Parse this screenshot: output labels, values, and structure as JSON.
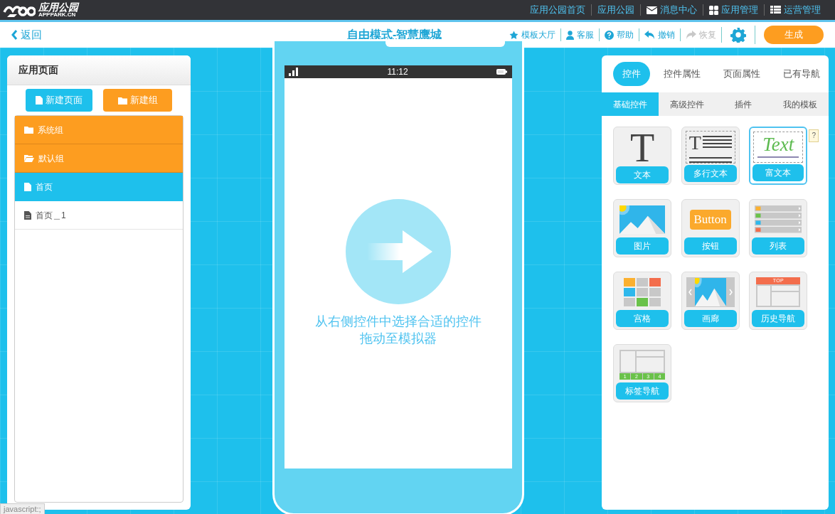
{
  "top_bar": {
    "logo_text": "应用公园",
    "logo_sub": "APPPARK.CN",
    "links": [
      {
        "label": "应用公园首页",
        "kind": "plain"
      },
      {
        "label": "应用公园",
        "kind": "plain"
      },
      {
        "label": "消息中心",
        "kind": "mail"
      },
      {
        "label": "应用管理",
        "kind": "apps"
      },
      {
        "label": "运营管理",
        "kind": "list"
      }
    ]
  },
  "toolbar": {
    "back": "返回",
    "title": "自由模式-智慧鹰城",
    "actions": [
      {
        "label": "模板大厅",
        "kind": "star",
        "disabled": false
      },
      {
        "label": "客服",
        "kind": "user",
        "disabled": false
      },
      {
        "label": "帮助",
        "kind": "help",
        "disabled": false
      },
      {
        "label": "撤销",
        "kind": "undo",
        "disabled": false
      },
      {
        "label": "恢复",
        "kind": "redo",
        "disabled": true
      }
    ],
    "generate": "生成"
  },
  "pages_panel": {
    "title": "应用页面",
    "new_page": "新建页面",
    "new_group": "新建组",
    "items": [
      {
        "label": "系统组",
        "kind": "group",
        "expanded": false
      },
      {
        "label": "默认组",
        "kind": "group",
        "expanded": true
      },
      {
        "label": "首页",
        "kind": "page",
        "selected": true
      },
      {
        "label": "首页＿1",
        "kind": "page",
        "selected": false
      }
    ]
  },
  "simulator": {
    "time": "11:12",
    "hint": [
      "从右侧控件中选择合适的控件",
      "拖动至模拟器"
    ]
  },
  "widgets_panel": {
    "tabs": [
      {
        "label": "控件",
        "selected": true
      },
      {
        "label": "控件属性",
        "selected": false
      },
      {
        "label": "页面属性",
        "selected": false
      },
      {
        "label": "已有导航",
        "selected": false
      }
    ],
    "subtabs": [
      {
        "label": "基础控件",
        "selected": true
      },
      {
        "label": "高级控件",
        "selected": false
      },
      {
        "label": "插件",
        "selected": false
      },
      {
        "label": "我的模板",
        "selected": false
      }
    ],
    "help": "?",
    "widgets": [
      {
        "label": "文本",
        "kind": "text",
        "icon_text": "T",
        "selected": false
      },
      {
        "label": "多行文本",
        "kind": "multiline",
        "icon_text": "T",
        "selected": false
      },
      {
        "label": "富文本",
        "kind": "richtext",
        "icon_text": "Text",
        "selected": true
      },
      {
        "label": "图片",
        "kind": "image",
        "selected": false
      },
      {
        "label": "按钮",
        "kind": "button",
        "icon_text": "Button",
        "selected": false
      },
      {
        "label": "列表",
        "kind": "list",
        "selected": false
      },
      {
        "label": "宫格",
        "kind": "grid",
        "selected": false
      },
      {
        "label": "画廊",
        "kind": "gallery",
        "selected": false
      },
      {
        "label": "历史导航",
        "kind": "history",
        "icon_text": "TOP",
        "selected": false
      },
      {
        "label": "标签导航",
        "kind": "tabnav",
        "icon_labels": [
          "1",
          "2",
          "3",
          "4"
        ],
        "selected": false
      }
    ]
  },
  "status_bar": "javascript:;"
}
